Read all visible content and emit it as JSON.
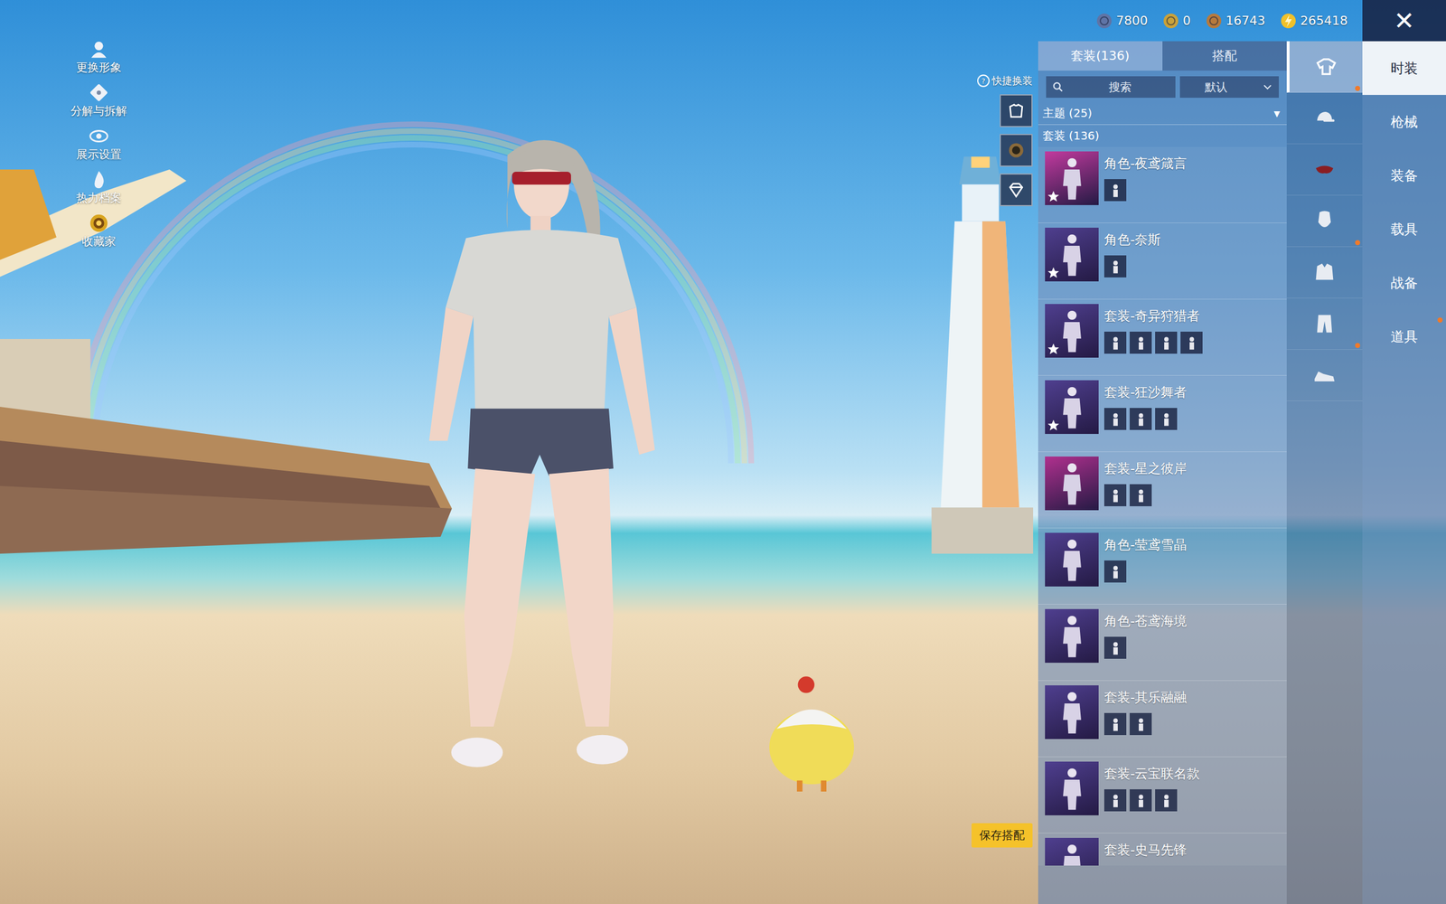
{
  "currencies": [
    {
      "amount": "7800",
      "kind": "gem",
      "color": "#5f74a6"
    },
    {
      "amount": "0",
      "kind": "coin",
      "color": "#c9a23a"
    },
    {
      "amount": "16743",
      "kind": "coin",
      "color": "#b77a3c"
    },
    {
      "amount": "265418",
      "kind": "bolt",
      "color": "#f0c12a"
    }
  ],
  "close": "✕",
  "left_menu": [
    {
      "label": "更换形象",
      "kind": "avatar"
    },
    {
      "label": "分解与拆解",
      "kind": "puzzle"
    },
    {
      "label": "展示设置",
      "kind": "eye"
    },
    {
      "label": "热力档案",
      "kind": "flame"
    },
    {
      "label": "收藏家",
      "kind": "collector"
    }
  ],
  "quick_change": {
    "label": "快捷换装",
    "help": "?",
    "slots": [
      {
        "kind": "top"
      },
      {
        "kind": "emblem"
      },
      {
        "kind": "diamond"
      }
    ]
  },
  "save_button": "保存搭配",
  "panel": {
    "tabs": [
      {
        "label": "套装(136)",
        "selected": true
      },
      {
        "label": "搭配",
        "selected": false
      }
    ],
    "search": {
      "placeholder": "搜索"
    },
    "sort": {
      "value": "默认"
    },
    "theme": {
      "label": "主题 (25)",
      "arrow": "▼"
    },
    "section": "套装 (136)",
    "items": [
      {
        "name": "角色-夜鸢箴言",
        "starred": true,
        "part_count": 1,
        "color": "#c23a9e"
      },
      {
        "name": "角色-奈斯",
        "starred": true,
        "part_count": 1,
        "color": "#4f3f8f"
      },
      {
        "name": "套装-奇异狩猎者",
        "starred": true,
        "part_count": 4,
        "color": "#4f3f8f"
      },
      {
        "name": "套装-狂沙舞者",
        "starred": true,
        "part_count": 3,
        "color": "#4f3f8f"
      },
      {
        "name": "套装-星之彼岸",
        "starred": false,
        "part_count": 2,
        "color": "#b0308e"
      },
      {
        "name": "角色-莹鸢雪晶",
        "starred": false,
        "part_count": 1,
        "color": "#4f3f8f"
      },
      {
        "name": "角色-苍鸢海境",
        "starred": false,
        "part_count": 1,
        "color": "#4f3f8f"
      },
      {
        "name": "套装-其乐融融",
        "starred": false,
        "part_count": 2,
        "color": "#4f3f8f"
      },
      {
        "name": "套装-云宝联名款",
        "starred": false,
        "part_count": 3,
        "color": "#4f3f8f"
      },
      {
        "name": "套装-史马先锋",
        "starred": false,
        "part_count": 0,
        "color": "#4f3f8f"
      }
    ]
  },
  "categories": [
    {
      "kind": "outfit",
      "selected": true,
      "badge": true
    },
    {
      "kind": "hat",
      "selected": false,
      "badge": false
    },
    {
      "kind": "mask",
      "selected": false,
      "badge": false
    },
    {
      "kind": "face",
      "selected": false,
      "badge": true
    },
    {
      "kind": "jacket",
      "selected": false,
      "badge": false
    },
    {
      "kind": "pants",
      "selected": false,
      "badge": true
    },
    {
      "kind": "shoes",
      "selected": false,
      "badge": false
    }
  ],
  "tabs": [
    {
      "label": "时装",
      "selected": true,
      "badge": false
    },
    {
      "label": "枪械",
      "selected": false,
      "badge": false
    },
    {
      "label": "装备",
      "selected": false,
      "badge": false
    },
    {
      "label": "载具",
      "selected": false,
      "badge": false
    },
    {
      "label": "战备",
      "selected": false,
      "badge": false
    },
    {
      "label": "道具",
      "selected": false,
      "badge": true
    }
  ]
}
